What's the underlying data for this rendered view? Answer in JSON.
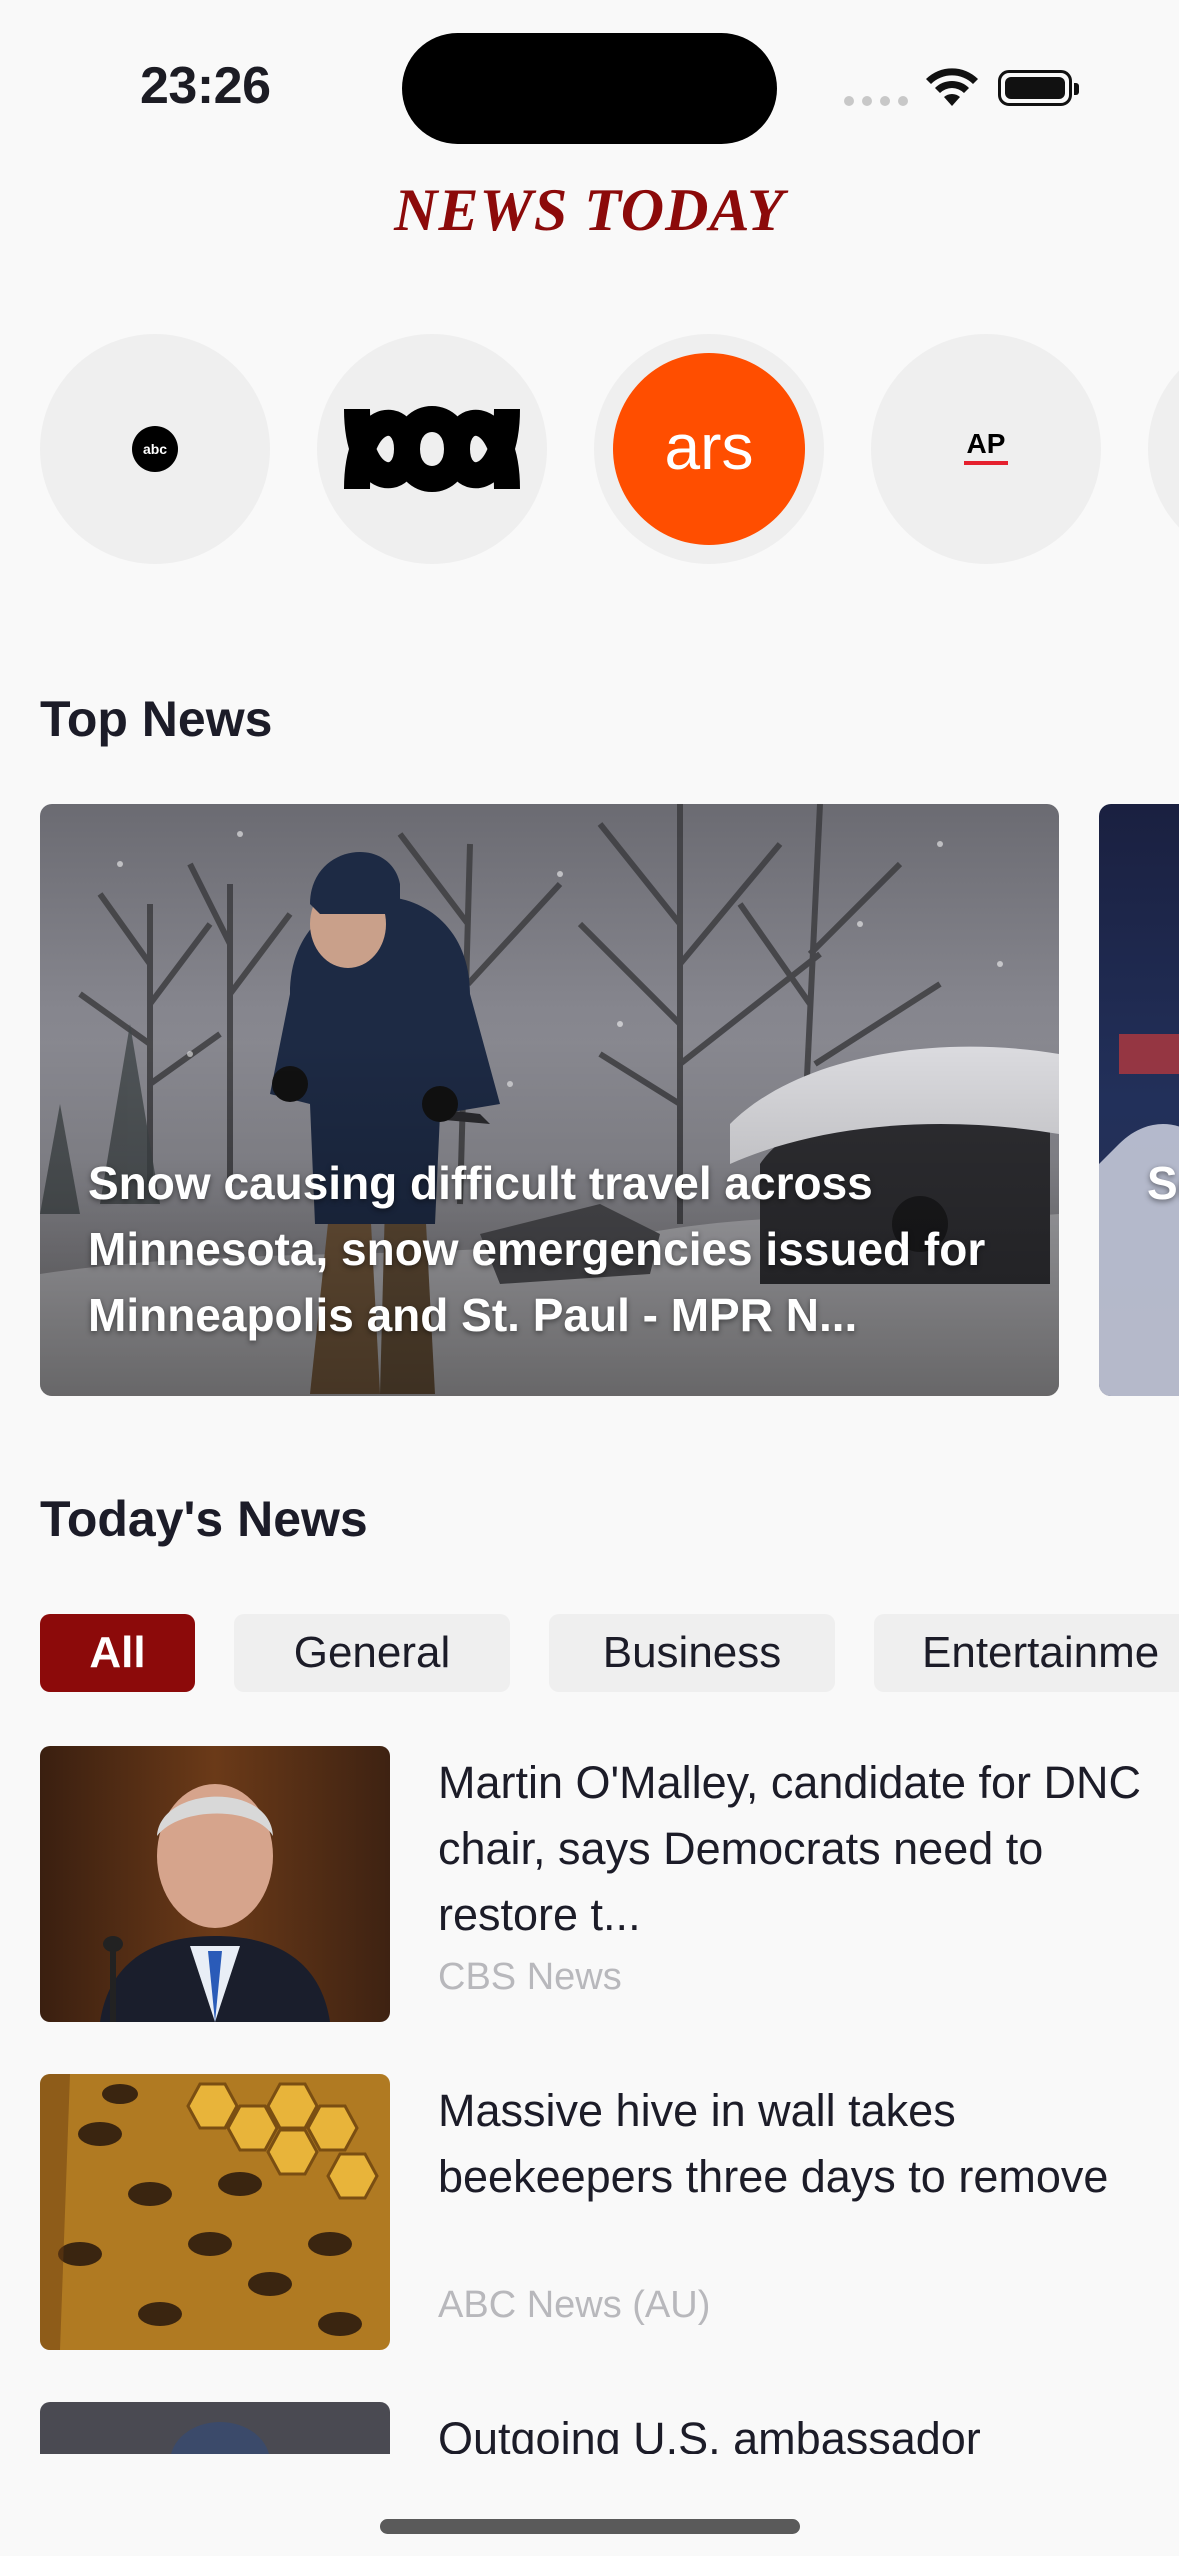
{
  "status_bar": {
    "time": "23:26"
  },
  "header": {
    "app_title": "NEWS TODAY"
  },
  "sources": [
    {
      "name": "abc",
      "icon": "abc-logo"
    },
    {
      "name": "ABC News (AU)",
      "icon": "abc-au-logo"
    },
    {
      "name": "ars",
      "icon": "ars-technica-logo",
      "color": "#ff4e00"
    },
    {
      "name": "AP",
      "icon": "ap-logo"
    }
  ],
  "top_news": {
    "section_title": "Top News",
    "cards": [
      {
        "title": "Snow causing difficult travel across Minnesota, snow emergencies issued for Minneapolis and St. Paul - MPR N..."
      },
      {
        "title": "Se sp fo"
      }
    ]
  },
  "todays_news": {
    "section_title": "Today's News",
    "filters": [
      "All",
      "General",
      "Business",
      "Entertainme"
    ],
    "active_filter": "All",
    "articles": [
      {
        "title": "Martin O'Malley, candidate for DNC chair, says Democrats need to restore t...",
        "source": "CBS News"
      },
      {
        "title": "Massive hive in wall takes beekeepers three days to remove",
        "source": "ABC News (AU)"
      },
      {
        "title": "Outgoing U.S. ambassador",
        "source": ""
      }
    ]
  },
  "colors": {
    "brand": "#8c0a0a",
    "chip_bg": "#efefef",
    "muted_text": "#b8b8bc"
  }
}
